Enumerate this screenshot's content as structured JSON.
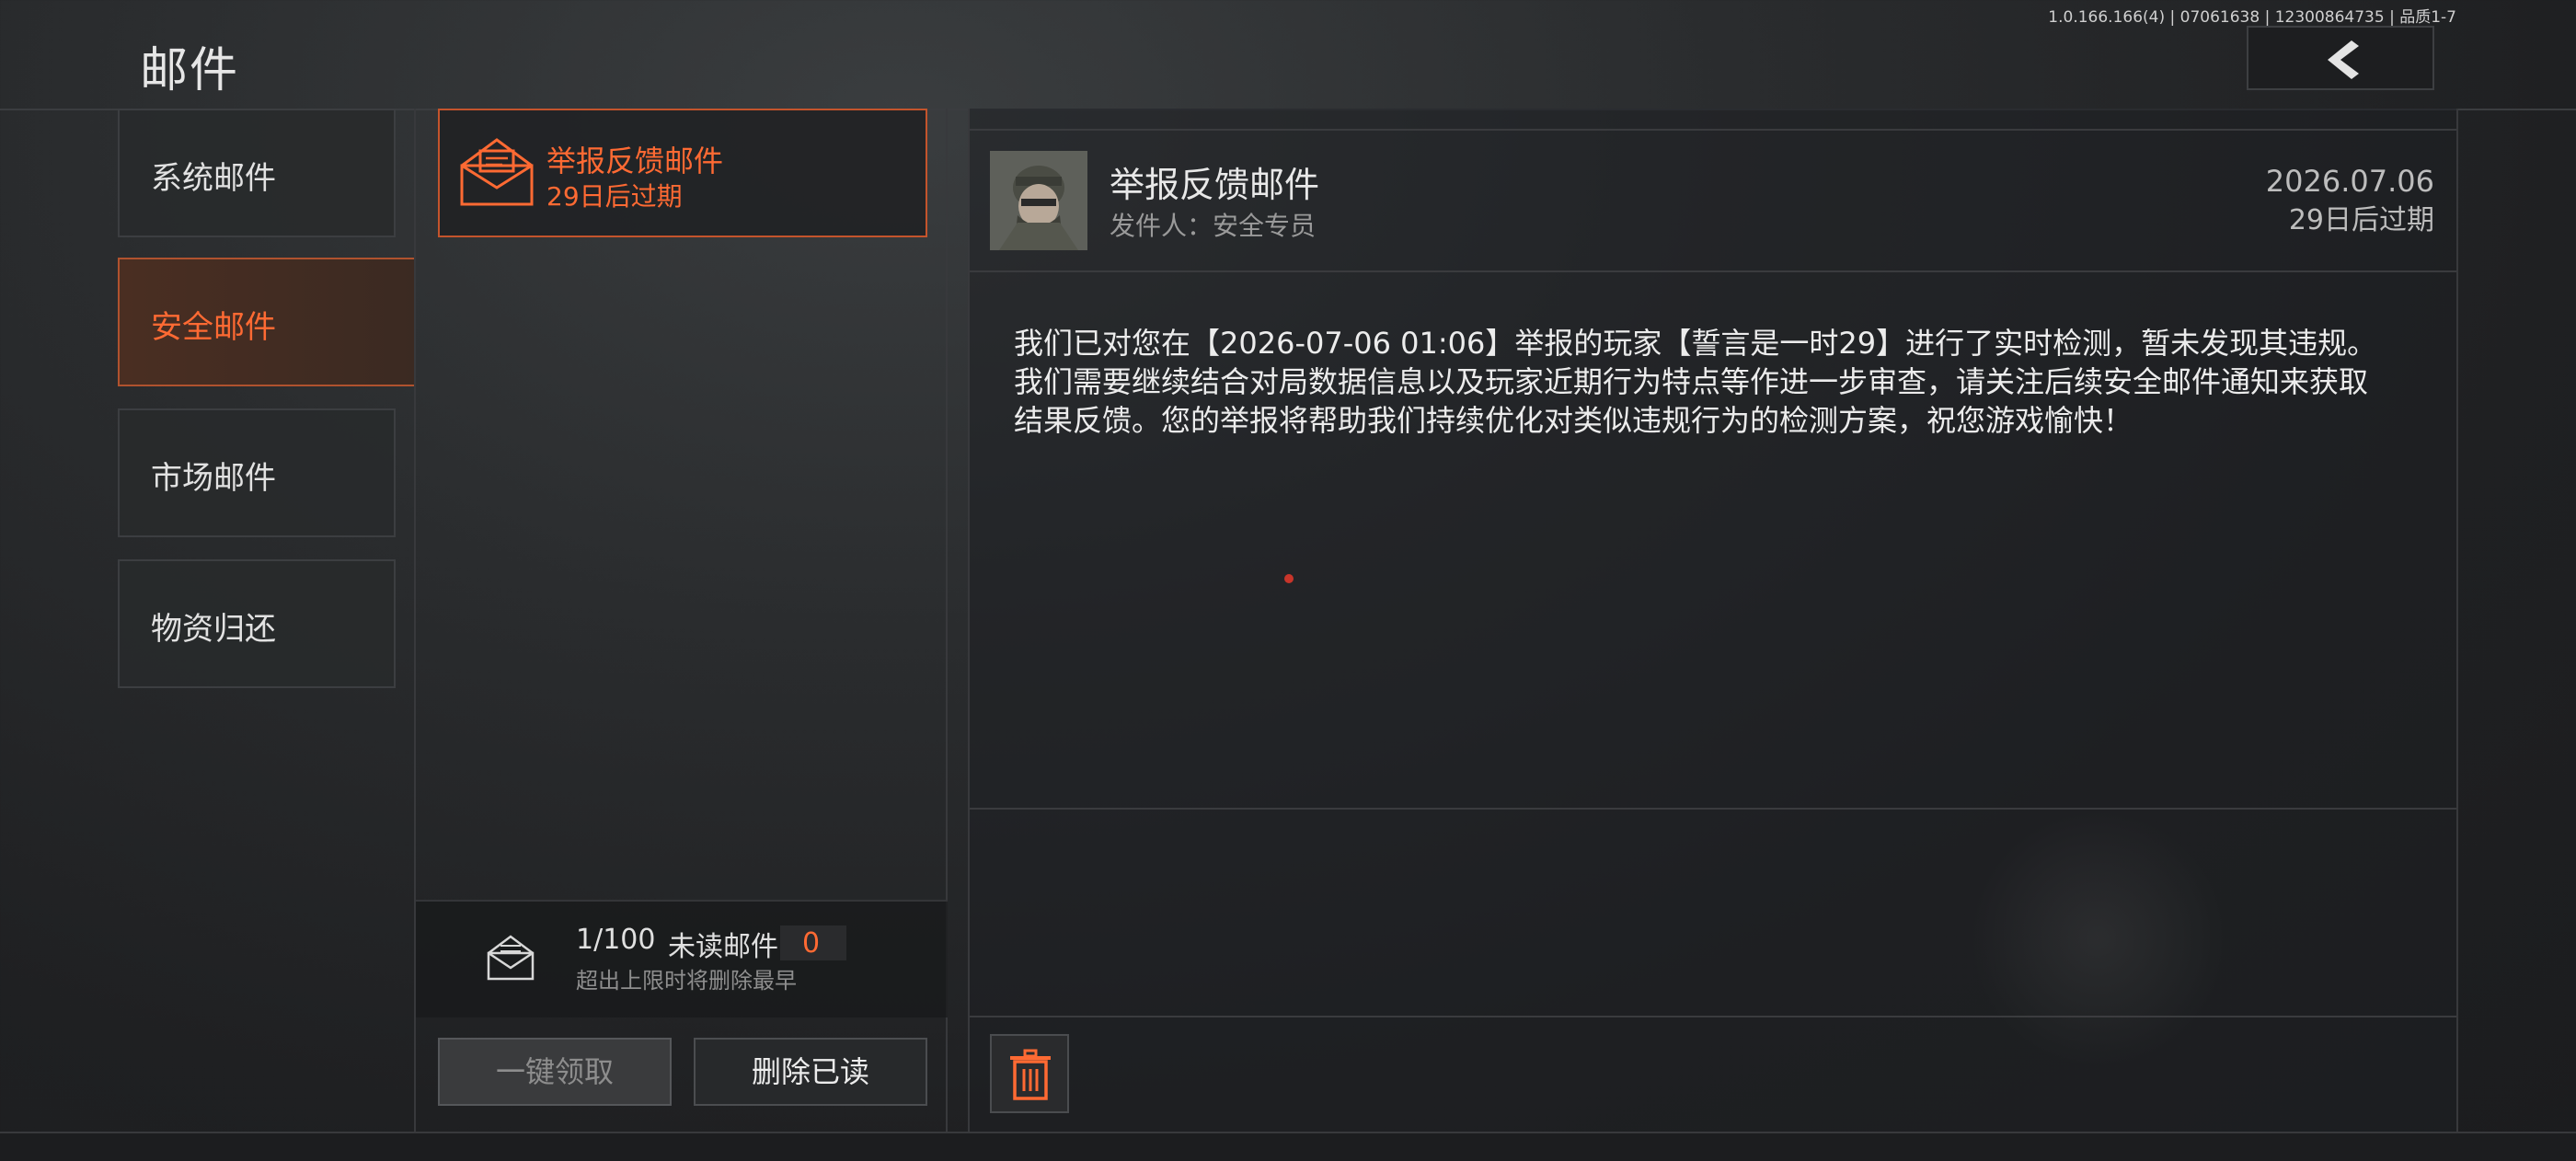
{
  "header": {
    "title": "邮件",
    "version": "1.0.166.166(4) | 07061638 | 12300864735 | 品质1-7"
  },
  "categories": [
    {
      "label": "系统邮件",
      "active": false
    },
    {
      "label": "安全邮件",
      "active": true
    },
    {
      "label": "市场邮件",
      "active": false
    },
    {
      "label": "物资归还",
      "active": false
    }
  ],
  "mail_list": [
    {
      "title": "举报反馈邮件",
      "expiry": "29日后过期",
      "icon": "envelope-open-icon"
    }
  ],
  "mailbox": {
    "count": "1/100",
    "unread_label": "未读邮件",
    "unread_count": "0",
    "note": "超出上限时将删除最早"
  },
  "actions": {
    "claim_all": "一键领取",
    "delete_read": "删除已读"
  },
  "detail": {
    "title": "举报反馈邮件",
    "sender": "发件人：安全专员",
    "date": "2026.07.06",
    "expiry": "29日后过期",
    "body": "我们已对您在【2026-07-06 01:06】举报的玩家【誓言是一时29】进行了实时检测，暂未发现其违规。我们需要继续结合对局数据信息以及玩家近期行为特点等作进一步审查，请关注后续安全邮件通知来获取结果反馈。您的举报将帮助我们持续优化对类似违规行为的检测方案，祝您游戏愉快！"
  },
  "colors": {
    "accent": "#ff6a33",
    "background": "#242628"
  }
}
